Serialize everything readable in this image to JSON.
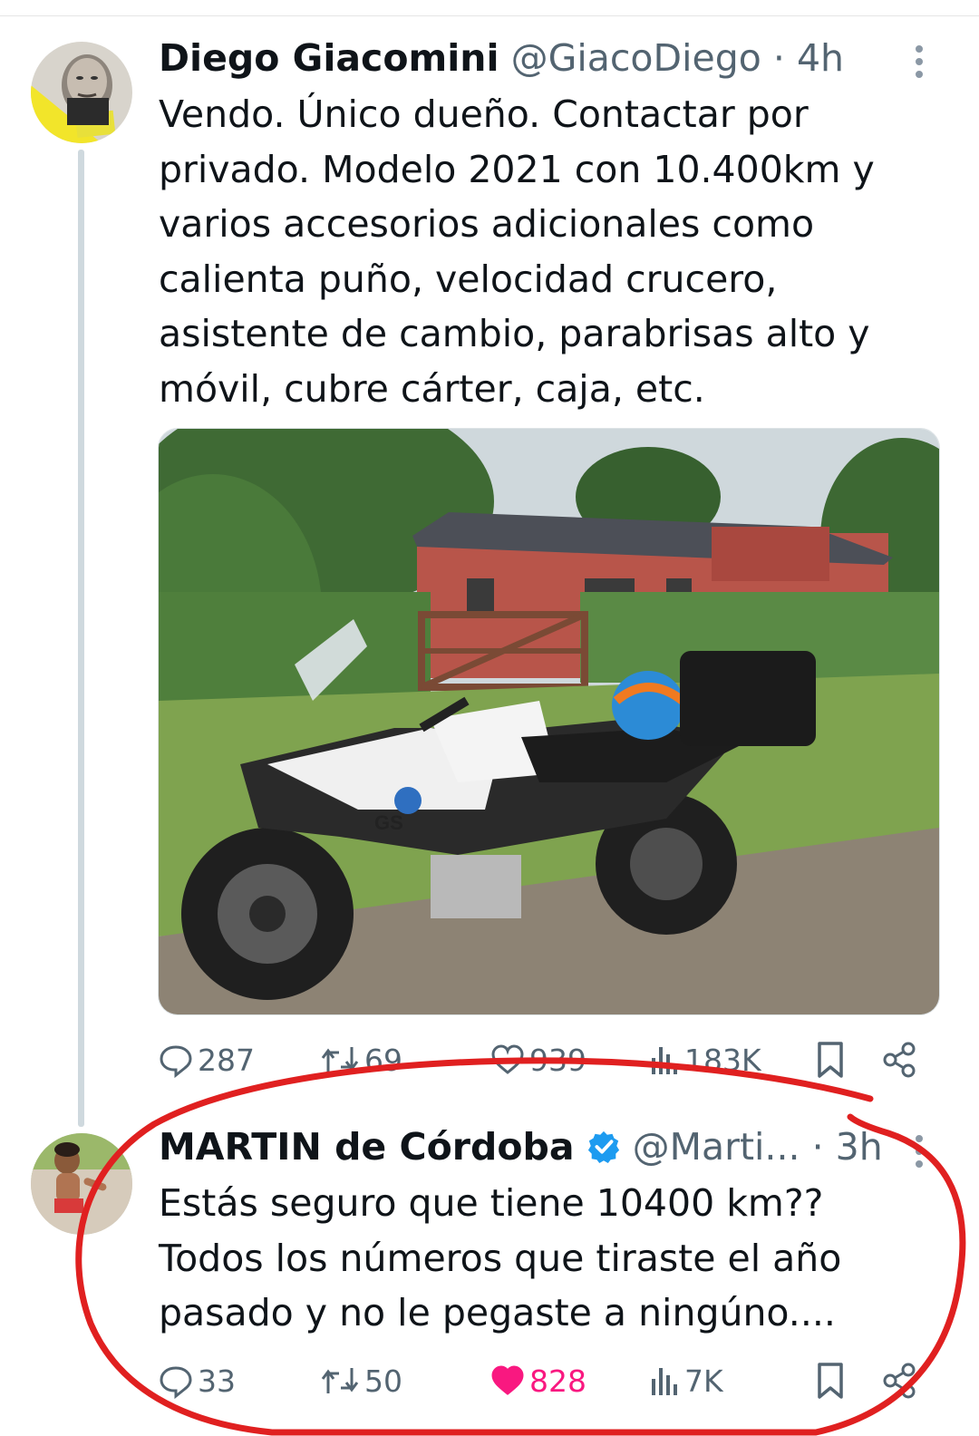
{
  "tweets": [
    {
      "author_name": "Diego Giacomini",
      "handle": "@GiacoDiego",
      "separator": "·",
      "time": "4h",
      "text_lines": [
        "Vendo. Único dueño. Contactar por",
        "privado. Modelo 2021 con 10.400km y",
        "varios accesorios adicionales como",
        "calienta puño, velocidad crucero,",
        "asistente de cambio, parabrisas alto y",
        "móvil, cubre cárter, caja, etc."
      ],
      "photo_bike_label": "GS",
      "stats": {
        "replies": "287",
        "retweets": "69",
        "likes": "939",
        "views": "183K"
      }
    },
    {
      "author_name": "MARTIN de Córdoba",
      "verified": true,
      "handle": "@Marti...",
      "separator": "·",
      "time": "3h",
      "text_lines": [
        "Estás seguro que tiene 10400 km??",
        "Todos los números que tiraste el año",
        "pasado y no le pegaste a ningúno...."
      ],
      "stats": {
        "replies": "33",
        "retweets": "50",
        "likes": "828",
        "views": "7K",
        "liked": true
      }
    }
  ],
  "colors": {
    "text": "#0f1419",
    "secondary": "#536471",
    "verified": "#1d9bf0",
    "like": "#f91880",
    "thread_line": "#cfd9de",
    "annotation": "#e02020"
  },
  "icons": [
    "more-icon",
    "reply-icon",
    "retweet-icon",
    "like-icon",
    "views-icon",
    "bookmark-icon",
    "share-icon",
    "verified-badge-icon"
  ]
}
